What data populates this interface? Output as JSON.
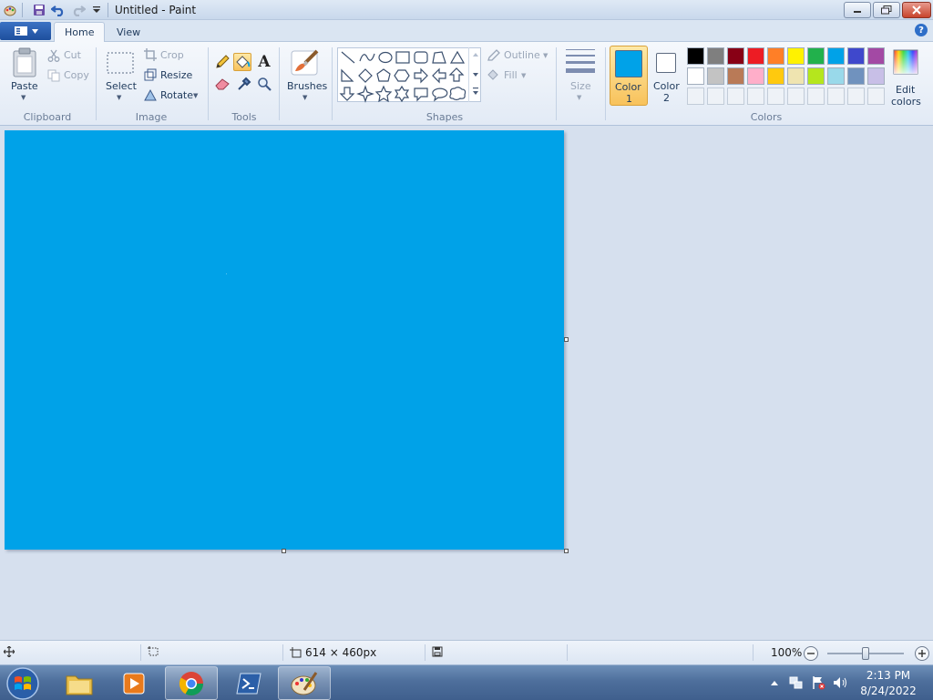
{
  "window": {
    "title": "Untitled - Paint"
  },
  "tabs": [
    {
      "label": "Home",
      "active": true
    },
    {
      "label": "View",
      "active": false
    }
  ],
  "ribbon": {
    "clipboard": {
      "label": "Clipboard",
      "paste": "Paste",
      "cut": "Cut",
      "copy": "Copy"
    },
    "image": {
      "label": "Image",
      "select": "Select",
      "crop": "Crop",
      "resize": "Resize",
      "rotate": "Rotate"
    },
    "tools": {
      "label": "Tools"
    },
    "brushes": {
      "label": "Brushes"
    },
    "shapes": {
      "label": "Shapes",
      "outline": "Outline",
      "fill": "Fill"
    },
    "size": {
      "label": "Size"
    },
    "colors": {
      "label": "Colors",
      "color1_line1": "Color",
      "color1_line2": "1",
      "color2_line1": "Color",
      "color2_line2": "2",
      "edit_line1": "Edit",
      "edit_line2": "colors",
      "color1_value": "#00a2e8",
      "color2_value": "#ffffff",
      "palette_row1": [
        "#000000",
        "#7f7f7f",
        "#880015",
        "#ed1c24",
        "#ff7f27",
        "#fff200",
        "#22b14c",
        "#00a2e8",
        "#3f48cc",
        "#a349a4"
      ],
      "palette_row2": [
        "#ffffff",
        "#c3c3c3",
        "#b97a57",
        "#ffaec9",
        "#ffc90e",
        "#efe4b0",
        "#b5e61d",
        "#99d9ea",
        "#7092be",
        "#c8bfe7"
      ]
    }
  },
  "canvas": {
    "fill_color": "#00a2e8",
    "width": 614,
    "height": 460
  },
  "status": {
    "dimensions": "614 × 460px",
    "zoom": "100%",
    "zoom_level": 1.0
  },
  "taskbar": {
    "time": "2:13 PM",
    "date": "8/24/2022"
  }
}
